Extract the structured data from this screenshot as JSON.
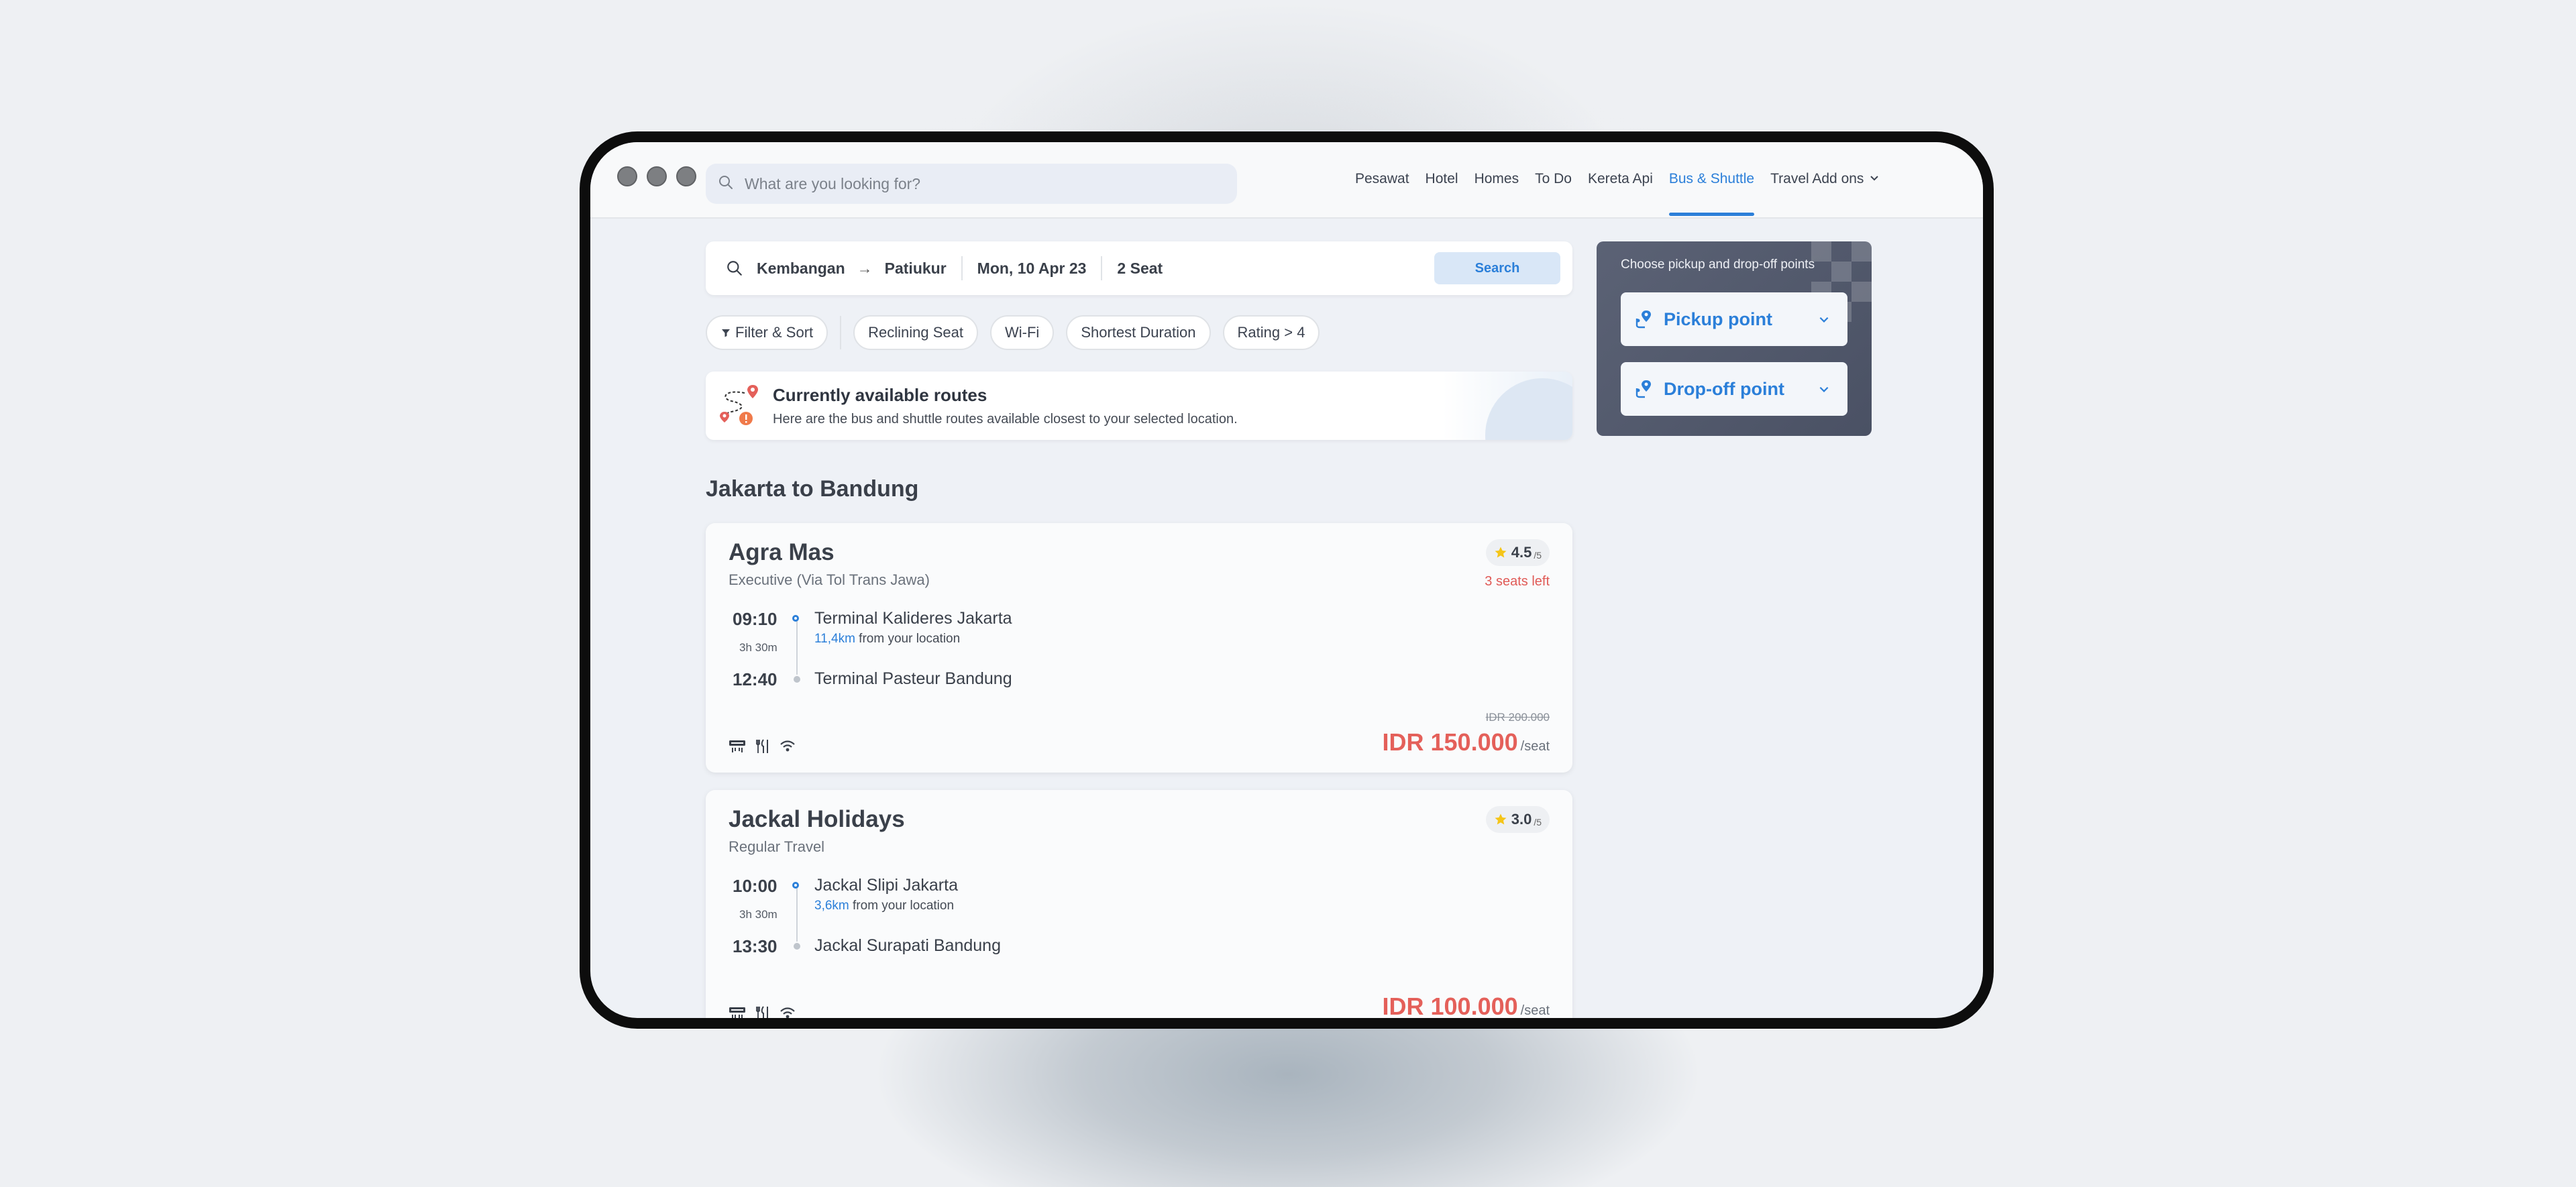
{
  "header": {
    "search_placeholder": "What are you looking for?",
    "nav": [
      "Pesawat",
      "Hotel",
      "Homes",
      "To Do",
      "Kereta Api",
      "Bus & Shuttle",
      "Travel Add ons"
    ],
    "active_nav": "Bus & Shuttle"
  },
  "search": {
    "from": "Kembangan",
    "to": "Patiukur",
    "date": "Mon, 10 Apr 23",
    "seats": "2 Seat",
    "button": "Search"
  },
  "filters": [
    "Filter & Sort",
    "Reclining Seat",
    "Wi-Fi",
    "Shortest Duration",
    "Rating > 4"
  ],
  "available": {
    "title": "Currently available routes",
    "desc": "Here are the bus and shuttle routes available closest to your selected location."
  },
  "section_title": "Jakarta to Bandung",
  "results": [
    {
      "name": "Agra Mas",
      "class": "Executive (Via Tol Trans Jawa)",
      "rating": "4.5",
      "rating_scale": "/5",
      "seats_left": "3 seats left",
      "depart_time": "09:10",
      "duration": "3h 30m",
      "arrive_time": "12:40",
      "origin": "Terminal Kalideres Jakarta",
      "distance_km": "11,4km",
      "distance_suffix": " from your location",
      "destination": "Terminal Pasteur Bandung",
      "old_price": "IDR 200.000",
      "price": "IDR 150.000",
      "unit": "/seat"
    },
    {
      "name": "Jackal Holidays",
      "class": "Regular Travel",
      "rating": "3.0",
      "rating_scale": "/5",
      "depart_time": "10:00",
      "duration": "3h 30m",
      "arrive_time": "13:30",
      "origin": "Jackal Slipi Jakarta",
      "distance_km": "3,6km",
      "distance_suffix": " from your location",
      "destination": "Jackal Surapati Bandung",
      "price": "IDR 100.000",
      "unit": "/seat"
    }
  ],
  "panel": {
    "title": "Choose pickup and drop-off points",
    "pickup": "Pickup point",
    "dropoff": "Drop-off point"
  },
  "colors": {
    "accent": "#2b7fd9",
    "price": "#e4605a",
    "panel": "#555c70"
  },
  "icons": {
    "amenities": [
      "ac-icon",
      "meal-icon",
      "wifi-icon"
    ]
  }
}
